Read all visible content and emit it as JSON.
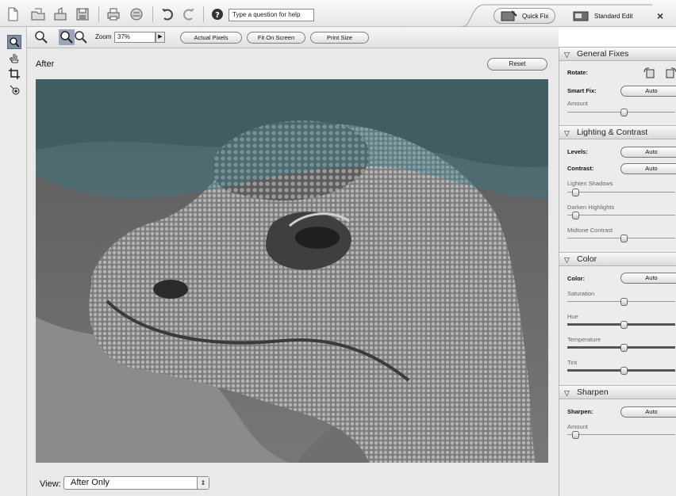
{
  "toolbar": {
    "icons": [
      "new-document-icon",
      "open-icon",
      "organizer-icon",
      "save-icon",
      "print-icon",
      "online-services-icon",
      "undo-icon",
      "redo-icon",
      "help-icon"
    ],
    "help_placeholder": "Type a question for help",
    "modes": [
      {
        "label": "Quick Fix",
        "icon": "quick-fix-icon",
        "active": true
      },
      {
        "label": "Standard Edit",
        "icon": "standard-edit-icon",
        "active": false
      }
    ],
    "close": "×"
  },
  "subbar": {
    "zoom_label": "Zoom",
    "zoom_value": "37%",
    "buttons": [
      "Actual Pixels",
      "Fit On Screen",
      "Print Size"
    ]
  },
  "tools": [
    "zoom-tool-icon",
    "hand-tool-icon",
    "crop-tool-icon",
    "red-eye-tool-icon"
  ],
  "main": {
    "title": "After",
    "reset": "Reset",
    "view_label": "View:",
    "view_value": "After Only"
  },
  "panel": {
    "general": {
      "title": "General Fixes",
      "rotate_label": "Rotate:",
      "smart_fix_label": "Smart Fix:",
      "smart_fix_button": "Auto",
      "amount_label": "Amount",
      "amount_level": 0.5
    },
    "lighting": {
      "title": "Lighting & Contrast",
      "levels_label": "Levels:",
      "levels_button": "Auto",
      "contrast_label": "Contrast:",
      "contrast_button": "Auto",
      "lighten_label": "Lighten Shadows",
      "lighten_level": 0.0,
      "darken_label": "Darken Highlights",
      "darken_level": 0.0,
      "midtone_label": "Midtone Contrast",
      "midtone_level": 0.5
    },
    "color": {
      "title": "Color",
      "color_label": "Color:",
      "color_button": "Auto",
      "saturation_label": "Saturation",
      "saturation_level": 0.5,
      "hue_label": "Hue",
      "hue_level": 0.5,
      "temperature_label": "Temperature",
      "temperature_level": 0.5,
      "tint_label": "Tint",
      "tint_level": 0.5
    },
    "sharpen": {
      "title": "Sharpen",
      "sharpen_label": "Sharpen:",
      "sharpen_button": "Auto",
      "amount_label": "Amount",
      "amount_level": 0.0
    }
  },
  "colors": {
    "tool_selected": "#7e8fa4",
    "background": "#e9e9e9"
  }
}
